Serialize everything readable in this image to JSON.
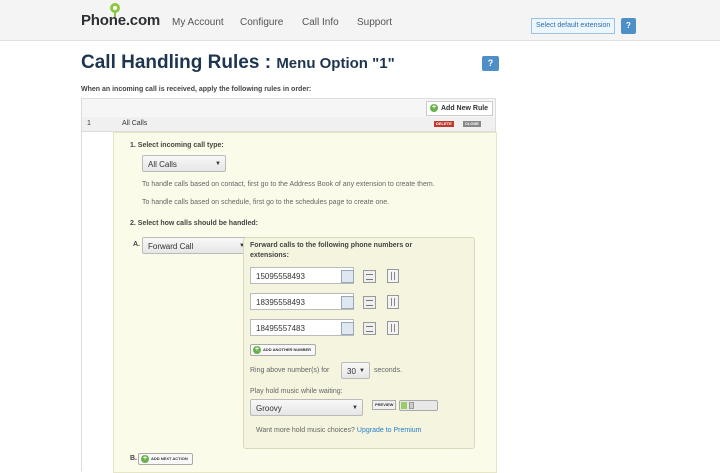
{
  "header": {
    "logo": "Phone.com",
    "nav": [
      "My Account",
      "Configure",
      "Call Info",
      "Support"
    ],
    "default_extension_button": "Select default extension",
    "help_label": "?"
  },
  "page": {
    "title": "Call Handling Rules :",
    "subtitle": "Menu Option \"1\"",
    "help_label": "?",
    "intro": "When an incoming call is received, apply the following rules in order:"
  },
  "rules": {
    "add_rule_label": "Add New Rule",
    "rule": {
      "number": "1",
      "name": "All Calls",
      "delete_label": "DELETE",
      "close_label": "CLOSE"
    },
    "step1": {
      "label": "1. Select incoming call type:",
      "selected": "All Calls",
      "hint_contact": "To handle calls based on contact, first go to the Address Book of any extension to create them.",
      "hint_schedule": "To handle calls based on schedule, first go to the schedules page to create one."
    },
    "step2": {
      "label": "2. Select how calls should be handled:",
      "action_a_letter": "A.",
      "action_a_selected": "Forward Call",
      "forward_title": "Forward calls to the following phone numbers or extensions:",
      "numbers": [
        "15095558493",
        "18395558493",
        "18495557483"
      ],
      "add_number_label": "ADD ANOTHER NUMBER",
      "ring_prefix": "Ring above number(s) for",
      "ring_value": "30",
      "ring_suffix": "seconds.",
      "hold_music_label": "Play hold music while waiting:",
      "hold_music_selected": "Groovy",
      "preview_label": "PREVIEW",
      "more_music_prefix": "Want more hold music choices?",
      "upgrade_link": "Upgrade to Premium",
      "action_b_letter": "B.",
      "add_next_label": "ADD NEXT ACTION"
    }
  }
}
